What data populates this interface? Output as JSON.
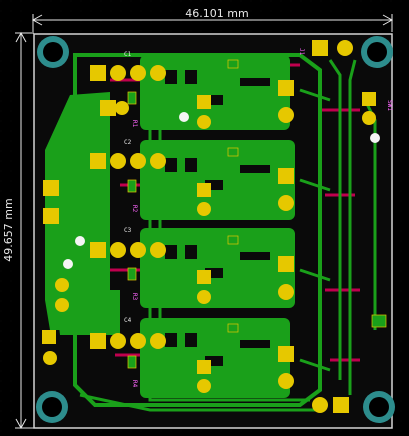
{
  "board": {
    "width_dimension": "46.101 mm",
    "height_dimension": "49.657 mm"
  },
  "colors": {
    "background": "#000000",
    "edge_cuts": "#d4d4d4",
    "dimension": "#e8e8e8",
    "copper_front": "#1aa01a",
    "copper_back": "#c0004e",
    "pad": "#e6c800",
    "mount_hole": "#2d8d8d",
    "silk_back": "#ff66ff",
    "silk_front": "#e8e8e8",
    "trace_outline": "#f0d800"
  },
  "silkscreen": {
    "top_labels": [
      "C1",
      "C2",
      "C3",
      "C4"
    ],
    "side_labels": [
      "R1",
      "R2",
      "R3",
      "R4"
    ],
    "connector_labels": [
      "J1",
      "SW1"
    ]
  }
}
